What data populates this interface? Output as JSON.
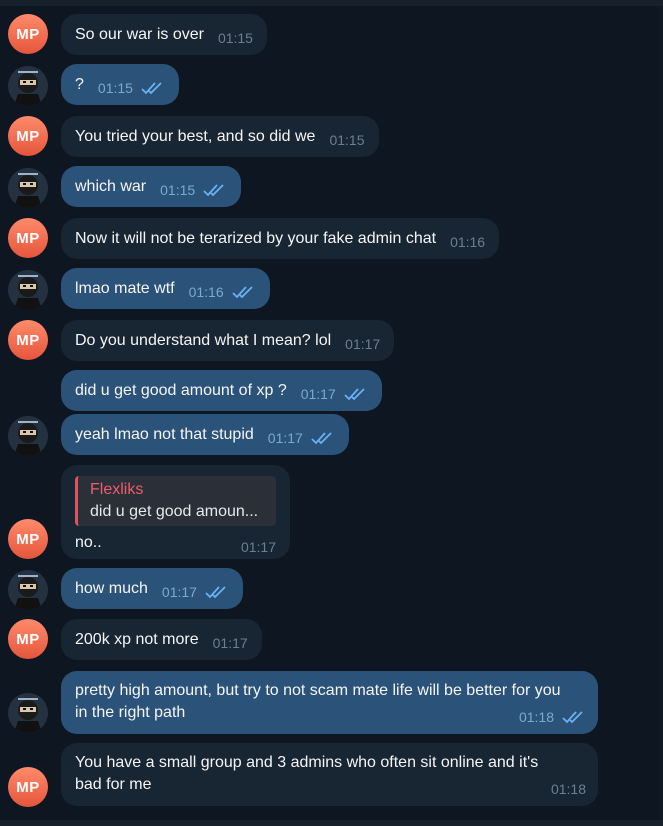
{
  "avatars": {
    "mp_initials": "MP",
    "mp_color": "#e5563c",
    "self_avatar_icon": "ninja-avatar-icon"
  },
  "messages": [
    {
      "sender": "MP",
      "text": "So our war is over",
      "time": "01:15"
    },
    {
      "sender": "self",
      "text": "?",
      "time": "01:15",
      "status": "read"
    },
    {
      "sender": "MP",
      "text": "You tried your best, and so did we",
      "time": "01:15"
    },
    {
      "sender": "self",
      "text": "which war",
      "time": "01:15",
      "status": "read"
    },
    {
      "sender": "MP",
      "text": "Now it will not be terarized by your fake admin chat",
      "time": "01:16"
    },
    {
      "sender": "self",
      "text": "lmao mate wtf",
      "time": "01:16",
      "status": "read"
    },
    {
      "sender": "MP",
      "text": "Do you understand what I mean? lol",
      "time": "01:17"
    },
    {
      "sender": "self",
      "text": "did u get good amount of xp ?",
      "time": "01:17",
      "status": "read"
    },
    {
      "sender": "self",
      "text": "yeah lmao not that stupid",
      "time": "01:17",
      "status": "read"
    },
    {
      "sender": "MP",
      "reply_to": {
        "name": "Flexliks",
        "text": "did u get good amoun..."
      },
      "text": "no..",
      "time": "01:17"
    },
    {
      "sender": "self",
      "text": "how much",
      "time": "01:17",
      "status": "read"
    },
    {
      "sender": "MP",
      "text": "200k xp not more",
      "time": "01:17"
    },
    {
      "sender": "self",
      "text": "pretty high amount, but try to not scam mate life will be better for you in the right path",
      "time": "01:18",
      "status": "read"
    },
    {
      "sender": "MP",
      "text": "You have a small group and 3 admins who often sit online and it's bad for me",
      "time": "01:18"
    }
  ],
  "colors": {
    "background": "#0e1621",
    "incoming_bubble": "#182533",
    "outgoing_bubble": "#2b5278",
    "reply_accent": "#e0525d",
    "read_ticks": "#6ab2f2"
  }
}
